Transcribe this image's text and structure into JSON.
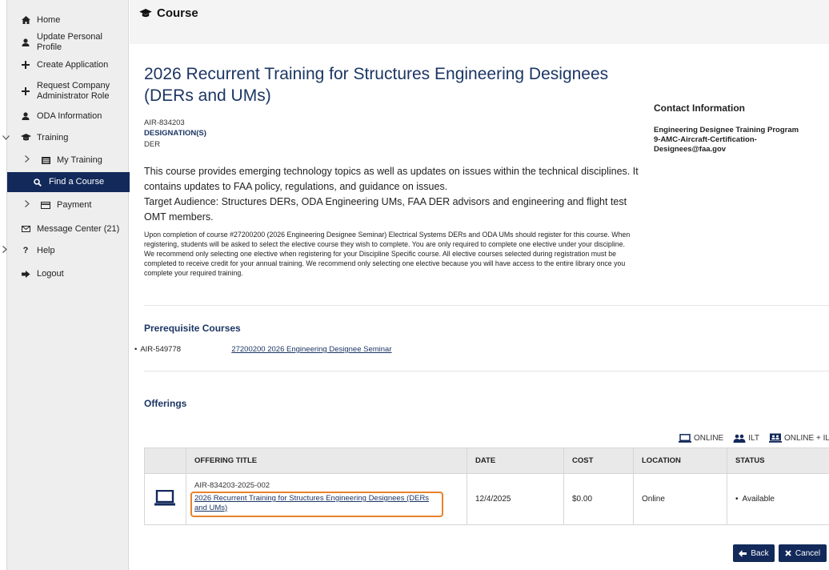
{
  "sidebar": {
    "items": [
      {
        "label": "Home",
        "icon": "home-icon"
      },
      {
        "label": "Update Personal Profile",
        "icon": "user-icon"
      },
      {
        "label": "Create Application",
        "icon": "plus-icon"
      },
      {
        "label": "Request Company Administrator Role",
        "icon": "plus-icon"
      },
      {
        "label": "ODA Information",
        "icon": "user-icon"
      },
      {
        "label": "Training",
        "icon": "graduation-cap-icon"
      },
      {
        "label": "My Training",
        "icon": "list-icon"
      },
      {
        "label": "Find a Course",
        "icon": "search-icon"
      },
      {
        "label": "Payment",
        "icon": "credit-card-icon"
      },
      {
        "label": "Message Center (21)",
        "icon": "envelope-icon"
      },
      {
        "label": "Help",
        "icon": "question-icon"
      },
      {
        "label": "Logout",
        "icon": "sign-out-icon"
      }
    ],
    "active_color": "#12295a"
  },
  "header": {
    "title": "Course"
  },
  "course": {
    "title": "2026 Recurrent Training for Structures Engineering Designees (DERs and UMs)",
    "id": "AIR-834203",
    "designations_label": "DESIGNATION(S)",
    "designation": "DER",
    "description": "This course provides emerging technology topics as well as updates on issues within the technical disciplines. It contains updates to FAA policy, regulations, and guidance on issues.",
    "audience": "Target Audience: Structures DERs, ODA Engineering UMs, FAA DER advisors and engineering and flight test OMT members.",
    "note": "Upon completion of course #27200200 (2026 Engineering Designee Seminar) Electrical Systems DERs and ODA UMs should register for this course. When registering, students will be asked to select the elective course they wish to complete. You are only required to complete one elective under your discipline. We recommend only selecting one elective when registering for your Discipline Specific course. All elective courses selected during registration must be completed to receive credit for your annual training. We recommend only selecting one elective because you will have access to the entire library once you complete your required training."
  },
  "contact": {
    "heading": "Contact Information",
    "name": "Engineering Designee Training Program",
    "email": "9-AMC-Aircraft-Certification-Designees@faa.gov"
  },
  "prereq": {
    "heading": "Prerequisite Courses",
    "id": "AIR-549778",
    "link": "27200200 2026 Engineering Designee Seminar"
  },
  "offerings": {
    "heading": "Offerings",
    "legend": {
      "online": "ONLINE",
      "ilt": "ILT",
      "online_ilt": "ONLINE + ILT"
    },
    "columns": {
      "title": "OFFERING TITLE",
      "date": "DATE",
      "cost": "COST",
      "location": "LOCATION",
      "status": "STATUS"
    },
    "row": {
      "id": "AIR-834203-2025-002",
      "title": "2026 Recurrent Training for Structures Engineering Designees (DERs and UMs)",
      "date": "12/4/2025",
      "cost": "$0.00",
      "location": "Online",
      "status": "Available",
      "type_icon": "laptop-icon"
    }
  },
  "buttons": {
    "back": "Back",
    "cancel": "Cancel"
  },
  "colors": {
    "brand_navy": "#12295a",
    "title_blue": "#1c3664",
    "highlight_orange": "#e8822a"
  }
}
